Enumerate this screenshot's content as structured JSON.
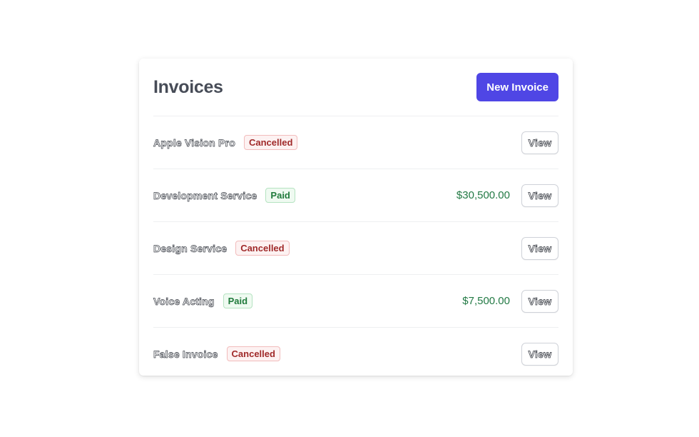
{
  "header": {
    "title": "Invoices",
    "new_button_label": "New Invoice"
  },
  "invoices": [
    {
      "name": "Apple Vision Pro",
      "status": "Cancelled",
      "amount": "",
      "action_label": "View"
    },
    {
      "name": "Development Service",
      "status": "Paid",
      "amount": "$30,500.00",
      "action_label": "View"
    },
    {
      "name": "Design Service",
      "status": "Cancelled",
      "amount": "",
      "action_label": "View"
    },
    {
      "name": "Voice Acting",
      "status": "Paid",
      "amount": "$7,500.00",
      "action_label": "View"
    },
    {
      "name": "False Invoice",
      "status": "Cancelled",
      "amount": "",
      "action_label": "View"
    }
  ],
  "colors": {
    "accent": "#4f46e5",
    "paid": "#1f7a3b",
    "cancelled": "#a02a2a",
    "amount": "#237a45"
  }
}
